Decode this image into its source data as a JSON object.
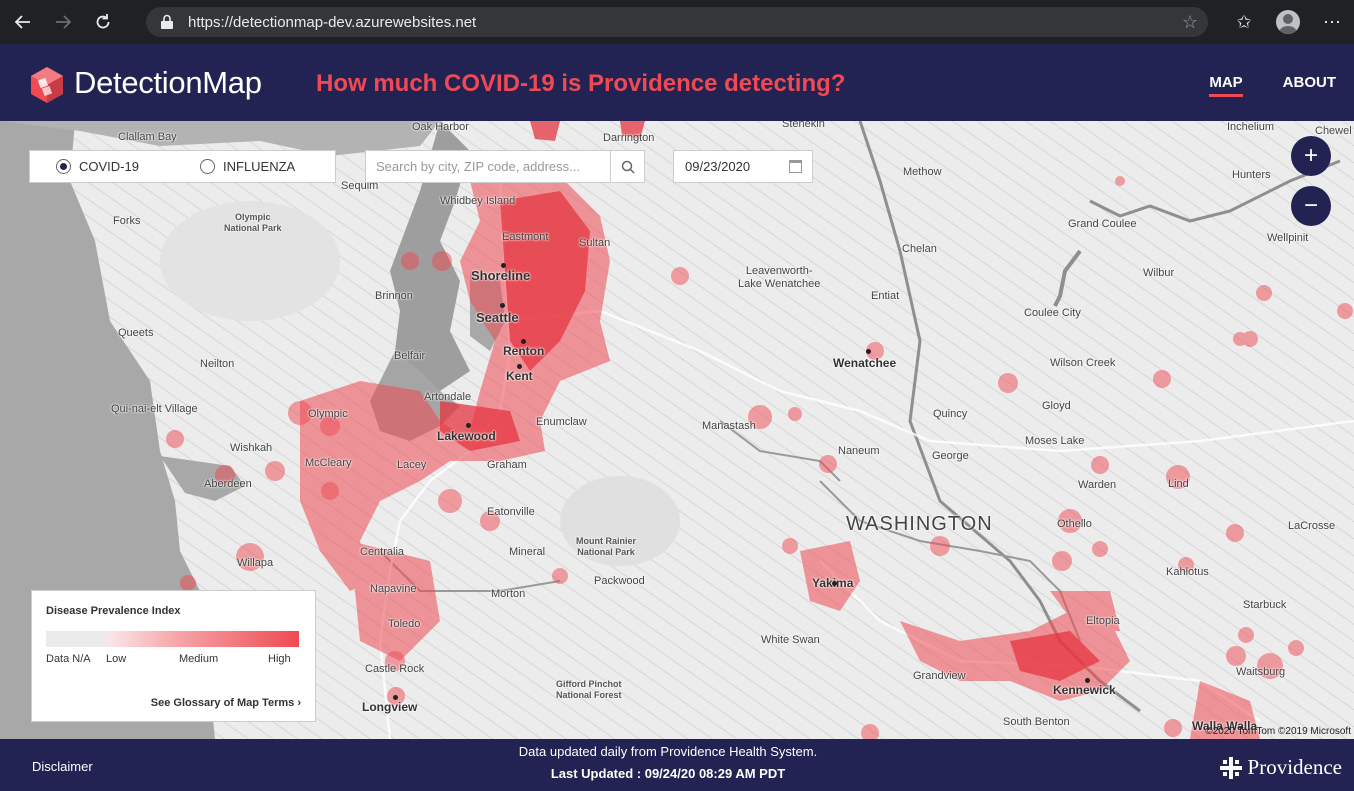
{
  "browser": {
    "url": "https://detectionmap-dev.azurewebsites.net"
  },
  "header": {
    "logo_text": "DetectionMap",
    "headline": "How much COVID-19 is Providence detecting?",
    "nav": [
      {
        "label": "MAP",
        "active": true
      },
      {
        "label": "ABOUT",
        "active": false
      }
    ]
  },
  "controls": {
    "options": [
      {
        "label": "COVID-19",
        "selected": true
      },
      {
        "label": "INFLUENZA",
        "selected": false
      }
    ],
    "search_placeholder": "Search by city, ZIP code, address...",
    "date": "09/23/2020",
    "zoom_in": "+",
    "zoom_out": "−"
  },
  "legend": {
    "title": "Disease Prevalence Index",
    "labels": [
      "Data N/A",
      "Low",
      "Medium",
      "High"
    ],
    "glossary_link": "See Glossary of Map Terms",
    "colors": {
      "na": "#ebebeb",
      "high": "#ef4a53"
    }
  },
  "map": {
    "state_label": "WASHINGTON",
    "copyright": "©2020 TomTom ©2019 Microsoft",
    "places": {
      "clallam_bay": "Clallam Bay",
      "oak_harbor": "Oak Harbor",
      "darrington": "Darrington",
      "stehekin": "Stehekin",
      "inchelium": "Inchelium",
      "chewelah": "Chewel",
      "sequim": "Sequim",
      "whidbey": "Whidbey Island",
      "methow": "Methow",
      "hunters": "Hunters",
      "forks": "Forks",
      "olympic_np": "Olympic\nNational Park",
      "eastmont": "Eastmont",
      "sultan": "Sultan",
      "grand_coulee": "Grand Coulee",
      "wellpinit": "Wellpinit",
      "chelan": "Chelan",
      "shoreline": "Shoreline",
      "leavenworth": "Leavenworth-\nLake Wenatchee",
      "wilbur": "Wilbur",
      "brinnon": "Brinnon",
      "entiat": "Entiat",
      "coulee_city": "Coulee City",
      "queets": "Queets",
      "seattle": "Seattle",
      "renton": "Renton",
      "belfair": "Belfair",
      "wenatchee": "Wenatchee",
      "wilson_creek": "Wilson Creek",
      "neilton": "Neilton",
      "kent": "Kent",
      "quinault": "Qui-nai-elt Village",
      "artondale": "Artondale",
      "olympic": "Olympic",
      "manastash": "Manastash",
      "quincy": "Quincy",
      "gloyd": "Gloyd",
      "enumclaw": "Enumclaw",
      "wishkah": "Wishkah",
      "lakewood": "Lakewood",
      "naneum": "Naneum",
      "moses_lake": "Moses Lake",
      "mccleary": "McCleary",
      "lacey": "Lacey",
      "graham": "Graham",
      "george": "George",
      "aberdeen": "Aberdeen",
      "lind": "Lind",
      "warden": "Warden",
      "eatonville": "Eatonville",
      "othello": "Othello",
      "lacrosse": "LaCrosse",
      "rainier": "Mount Rainier\nNational Park",
      "centralia": "Centralia",
      "mineral": "Mineral",
      "willapa": "Willapa",
      "yakima": "Yakima",
      "kahlotus": "Kahlotus",
      "packwood": "Packwood",
      "napavine": "Napavine",
      "morton": "Morton",
      "starbuck": "Starbuck",
      "toledo": "Toledo",
      "eltopia": "Eltopia",
      "white_swan": "White Swan",
      "castle_rock": "Castle Rock",
      "grandview": "Grandview",
      "waitsburg": "Waitsburg",
      "gifford": "Gifford Pinchot\nNational Forest",
      "kennewick": "Kennewick",
      "longview": "Longview",
      "south_benton": "South Benton",
      "walla_walla": "Walla Walla"
    }
  },
  "footer": {
    "disclaimer": "Disclaimer",
    "line1": "Data updated daily from Providence Health System.",
    "line2": "Last Updated : 09/24/20 08:29 AM PDT",
    "brand": "Providence"
  }
}
